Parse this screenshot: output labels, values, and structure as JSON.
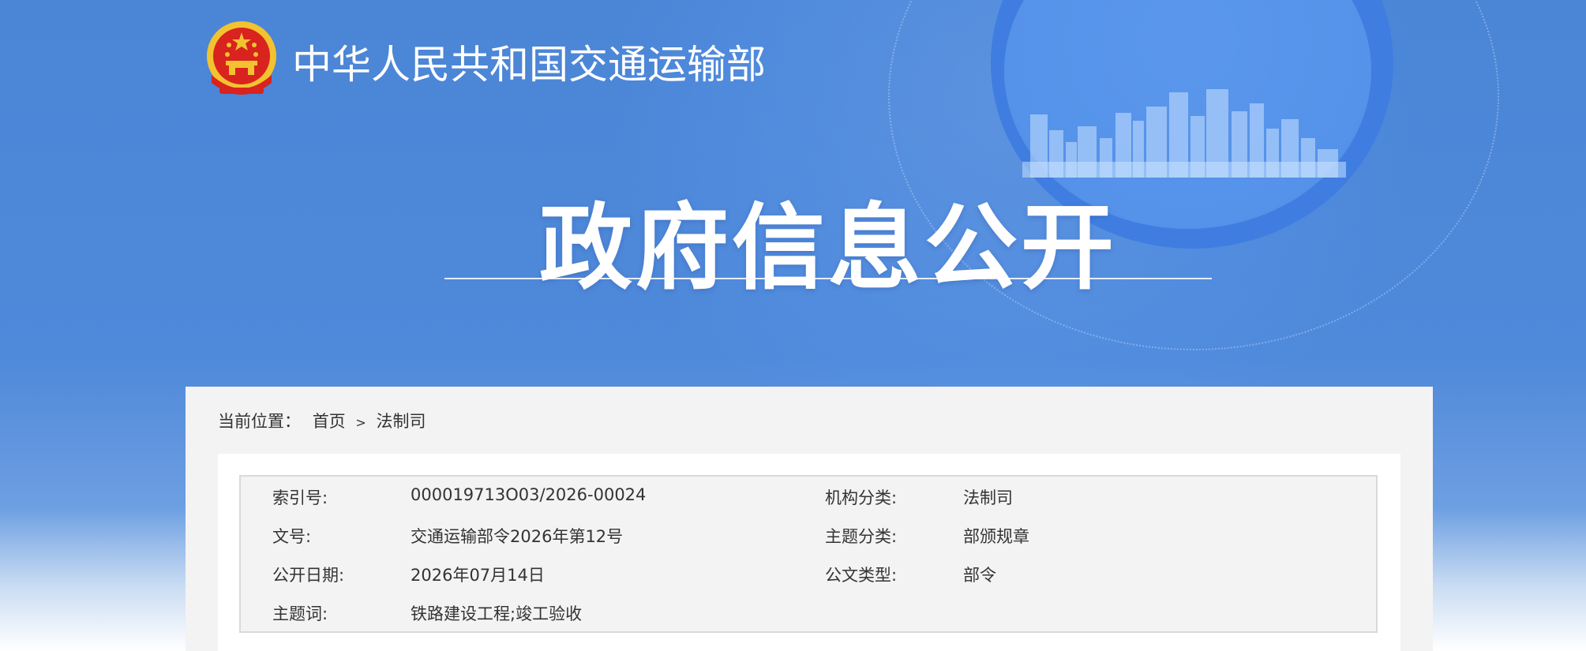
{
  "header": {
    "ministry_name": "中华人民共和国交通运输部",
    "headline": "政府信息公开"
  },
  "breadcrumb": {
    "label": "当前位置：",
    "items": [
      "首页",
      "法制司"
    ],
    "separator": ">"
  },
  "info": {
    "index_label": "索引号:",
    "index_value": "000019713O03/2026-00024",
    "org_label": "机构分类:",
    "org_value": "法制司",
    "doc_no_label": "文号:",
    "doc_no_value": "交通运输部令2026年第12号",
    "topic_label": "主题分类:",
    "topic_value": "部颁规章",
    "date_label": "公开日期:",
    "date_value": "2026年07月14日",
    "type_label": "公文类型:",
    "type_value": "部令",
    "keywords_label": "主题词:",
    "keywords_value": "铁路建设工程;竣工验收"
  },
  "colors": {
    "banner_blue": "#4f88d8",
    "panel_gray": "#f3f3f3",
    "text_dark": "#333333",
    "emblem_red": "#d8231f",
    "emblem_gold": "#f3c230"
  }
}
